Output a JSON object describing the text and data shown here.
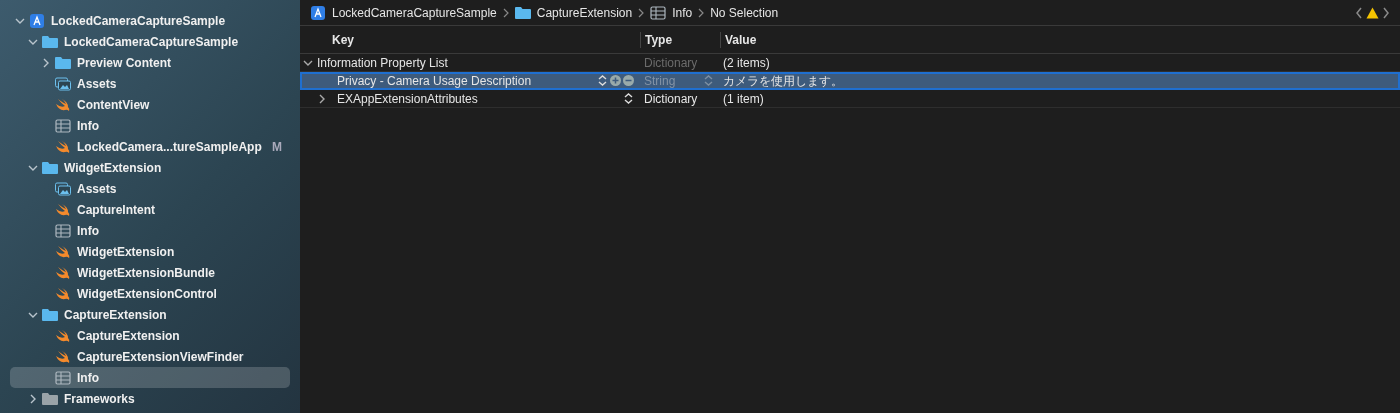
{
  "navigator": {
    "items": [
      {
        "label": "LockedCameraCaptureSample",
        "kind": "project",
        "expanded": true,
        "selected": false,
        "children": [
          {
            "label": "LockedCameraCaptureSample",
            "kind": "folder",
            "expanded": true,
            "selected": false,
            "children": [
              {
                "label": "Preview Content",
                "kind": "folder",
                "expanded": false,
                "selected": false
              },
              {
                "label": "Assets",
                "kind": "assets",
                "selected": false
              },
              {
                "label": "ContentView",
                "kind": "swift",
                "selected": false
              },
              {
                "label": "Info",
                "kind": "plist",
                "selected": false
              },
              {
                "label": "LockedCamera...tureSampleApp",
                "kind": "swift",
                "selected": false,
                "badge": "M"
              }
            ]
          },
          {
            "label": "WidgetExtension",
            "kind": "folder",
            "expanded": true,
            "selected": false,
            "children": [
              {
                "label": "Assets",
                "kind": "assets",
                "selected": false
              },
              {
                "label": "CaptureIntent",
                "kind": "swift",
                "selected": false
              },
              {
                "label": "Info",
                "kind": "plist",
                "selected": false
              },
              {
                "label": "WidgetExtension",
                "kind": "swift",
                "selected": false
              },
              {
                "label": "WidgetExtensionBundle",
                "kind": "swift",
                "selected": false
              },
              {
                "label": "WidgetExtensionControl",
                "kind": "swift",
                "selected": false
              }
            ]
          },
          {
            "label": "CaptureExtension",
            "kind": "folder",
            "expanded": true,
            "selected": false,
            "children": [
              {
                "label": "CaptureExtension",
                "kind": "swift",
                "selected": false
              },
              {
                "label": "CaptureExtensionViewFinder",
                "kind": "swift",
                "selected": false
              },
              {
                "label": "Info",
                "kind": "plist",
                "selected": true
              }
            ]
          },
          {
            "label": "Frameworks",
            "kind": "group",
            "expanded": false,
            "selected": false
          }
        ]
      }
    ]
  },
  "breadcrumb": [
    {
      "label": "LockedCameraCaptureSample",
      "kind": "project"
    },
    {
      "label": "CaptureExtension",
      "kind": "folder"
    },
    {
      "label": "Info",
      "kind": "plist"
    },
    {
      "label": "No Selection",
      "kind": "none"
    }
  ],
  "editor": {
    "columns": [
      "Key",
      "Type",
      "Value"
    ],
    "rows": [
      {
        "key": "Information Property List",
        "type": "Dictionary",
        "value": "(2 items)",
        "expanded": true,
        "selected": false,
        "type_disabled": true,
        "children": [
          {
            "key": "Privacy - Camera Usage Description",
            "type": "String",
            "value": "カメラを使用します。",
            "kind": "entry",
            "selected": true,
            "type_disabled": true
          },
          {
            "key": "EXAppExtensionAttributes",
            "type": "Dictionary",
            "value": "(1 item)",
            "kind": "entry",
            "expanded": false,
            "selected": false,
            "type_disabled": false
          }
        ]
      }
    ]
  }
}
